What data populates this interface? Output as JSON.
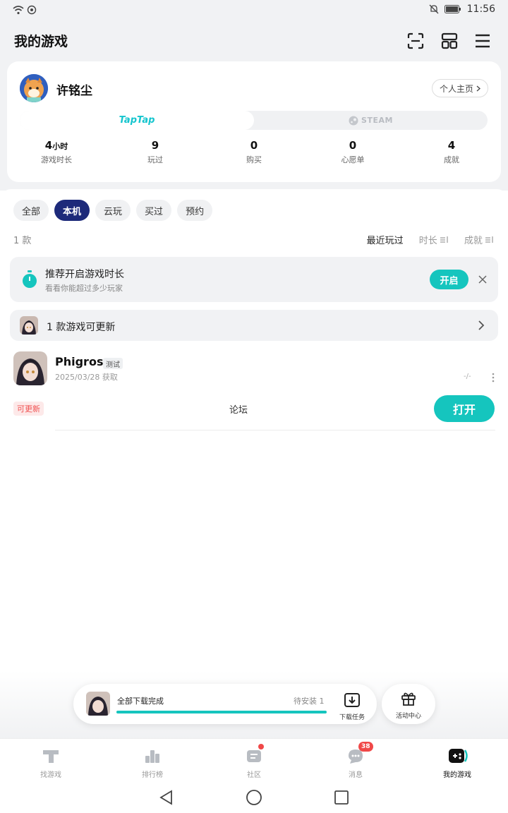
{
  "status_bar": {
    "time": "11:56"
  },
  "header": {
    "title": "我的游戏"
  },
  "profile": {
    "name": "许铭尘",
    "homepage_label": "个人主页",
    "platforms": [
      "TapTap",
      "STEAM"
    ],
    "stats": [
      {
        "value": "4",
        "unit": "小时",
        "label": "游戏时长"
      },
      {
        "value": "9",
        "unit": "",
        "label": "玩过"
      },
      {
        "value": "0",
        "unit": "",
        "label": "购买"
      },
      {
        "value": "0",
        "unit": "",
        "label": "心愿单"
      },
      {
        "value": "4",
        "unit": "",
        "label": "成就"
      }
    ]
  },
  "filters": {
    "tabs": [
      "全部",
      "本机",
      "云玩",
      "买过",
      "预约"
    ],
    "active": "本机"
  },
  "list": {
    "count": "1 款",
    "sort": [
      "最近玩过",
      "时长",
      "成就"
    ]
  },
  "promo": {
    "title": "推荐开启游戏时长",
    "subtitle": "看看你能超过多少玩家",
    "button": "开启"
  },
  "update_bar": {
    "text": "1 款游戏可更新"
  },
  "game": {
    "name": "Phigros",
    "badge": "测试",
    "acquired": "2025/03/28 获取",
    "playtime": "-/-",
    "tag": "可更新",
    "forum": "论坛",
    "open_button": "打开"
  },
  "download": {
    "title": "全部下载完成",
    "pending": "待安装 1",
    "progress": 1.0,
    "task_label": "下载任务",
    "event_label": "活动中心"
  },
  "bottom_nav": {
    "items": [
      "找游戏",
      "排行榜",
      "社区",
      "消息",
      "我的游戏"
    ],
    "message_badge": "38",
    "active": "我的游戏"
  },
  "colors": {
    "accent": "#15c5be",
    "active_tab": "#1d2a7a",
    "alert": "#f04848"
  }
}
